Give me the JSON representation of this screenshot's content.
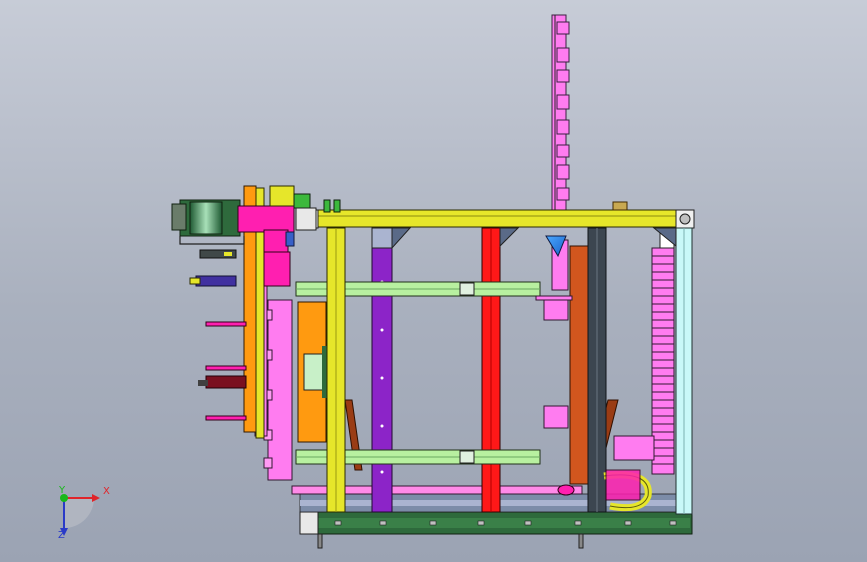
{
  "viewport": {
    "background_top": "#c7ccd7",
    "background_bottom": "#9ba3b3"
  },
  "triad": {
    "x_label": "X",
    "y_label": "Y",
    "z_label": "Z",
    "x_color": "#e0242a",
    "y_color": "#18b81a",
    "z_color": "#2a3ac8"
  },
  "part_colors": {
    "frame_yellow": "#e6e62a",
    "pink": "#ff7cf0",
    "magenta": "#ff1fb0",
    "purple": "#8c24c8",
    "red": "#ff1818",
    "green_rail": "#b8f0a0",
    "orange": "#ff9a10",
    "rust": "#d2561e",
    "dark_gray": "#3c4650",
    "steel_blue": "#5a7090",
    "cyan": "#c8f8f8",
    "dark_green": "#2e6a3c"
  }
}
